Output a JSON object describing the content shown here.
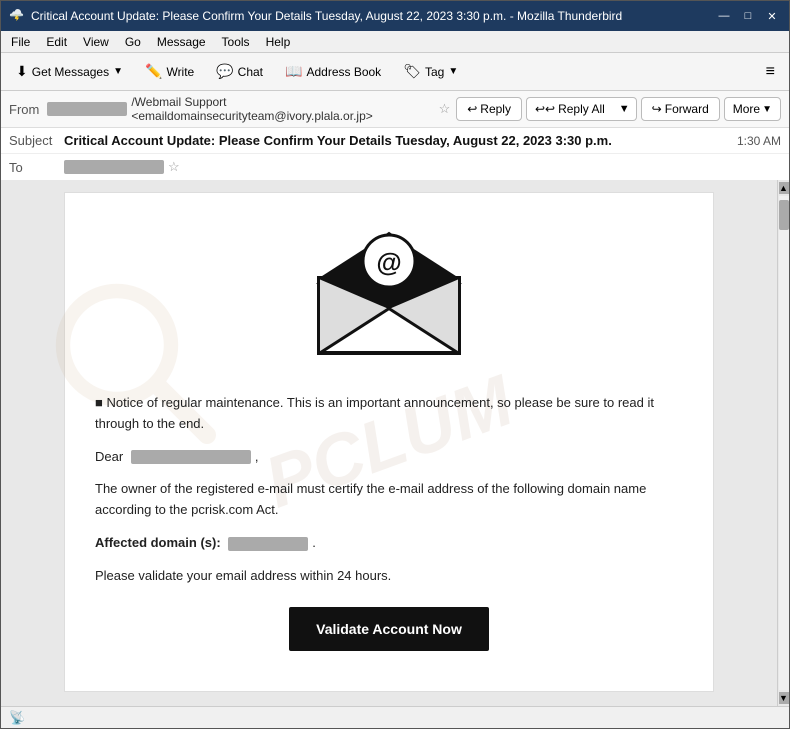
{
  "window": {
    "title": "Critical Account Update: Please Confirm Your Details Tuesday, August 22, 2023 3:30 p.m. - Mozilla Thunderbird",
    "icon": "🌩️"
  },
  "window_controls": {
    "minimize": "—",
    "maximize": "□",
    "close": "✕"
  },
  "menu": {
    "items": [
      "File",
      "Edit",
      "View",
      "Go",
      "Message",
      "Tools",
      "Help"
    ]
  },
  "toolbar": {
    "get_messages_label": "Get Messages",
    "write_label": "Write",
    "chat_label": "Chat",
    "address_book_label": "Address Book",
    "tag_label": "Tag"
  },
  "email_header": {
    "from_label": "From",
    "from_sender_blurred": "████████",
    "from_sender_text": "/Webmail Support <emaildomainsecurityteam@ivory.plala.or.jp>",
    "subject_label": "Subject",
    "subject_text": "Critical Account Update: Please Confirm Your Details Tuesday, August 22, 2023 3:30 p.m.",
    "time": "1:30 AM",
    "to_label": "To",
    "to_blurred": "████████"
  },
  "reply_toolbar": {
    "reply_label": "Reply",
    "reply_all_label": "Reply All",
    "forward_label": "Forward",
    "more_label": "More"
  },
  "email_body": {
    "icon_alt": "email envelope with @ symbol",
    "notice_text": "■ Notice of regular maintenance. This is an important announcement, so please be sure to read it through to the end.",
    "dear_text": "Dear",
    "dear_blurred": "████████████",
    "paragraph1": "The owner of the registered e-mail must certify the e-mail address of the following domain name according to the pcrisk.com Act.",
    "affected_label": "Affected domain (s):",
    "affected_blurred": "████████",
    "paragraph2": "Please validate your email address within 24 hours.",
    "validate_btn": "Validate Account Now"
  },
  "status_bar": {
    "icon": "📡",
    "text": ""
  },
  "watermark_text": "PCLUM"
}
